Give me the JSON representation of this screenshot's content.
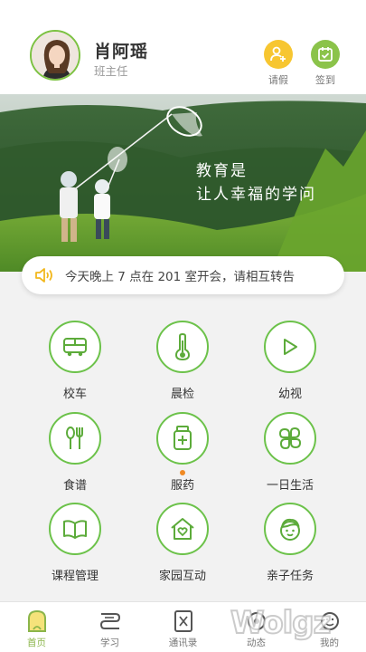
{
  "user": {
    "name": "肖阿瑶",
    "role": "班主任"
  },
  "header_actions": [
    {
      "label": "请假",
      "icon": "leave-icon"
    },
    {
      "label": "签到",
      "icon": "sign-in-icon"
    }
  ],
  "banner": {
    "line1": "教育是",
    "line2": "让人幸福的学问"
  },
  "notice": {
    "text": "今天晚上 7 点在 201 室开会，请相互转告"
  },
  "menu": [
    {
      "label": "校车",
      "icon": "bus-icon"
    },
    {
      "label": "晨检",
      "icon": "thermometer-icon"
    },
    {
      "label": "幼视",
      "icon": "play-icon"
    },
    {
      "label": "食谱",
      "icon": "fork-spoon-icon"
    },
    {
      "label": "服药",
      "icon": "medicine-icon",
      "badge": true
    },
    {
      "label": "一日生活",
      "icon": "clover-icon"
    },
    {
      "label": "课程管理",
      "icon": "book-icon"
    },
    {
      "label": "家园互动",
      "icon": "home-heart-icon"
    },
    {
      "label": "亲子任务",
      "icon": "kid-face-icon"
    }
  ],
  "tabs": [
    {
      "label": "首页",
      "icon": "home-tab-icon",
      "active": true
    },
    {
      "label": "学习",
      "icon": "study-tab-icon"
    },
    {
      "label": "通讯录",
      "icon": "contacts-tab-icon"
    },
    {
      "label": "动态",
      "icon": "moments-tab-icon"
    },
    {
      "label": "我的",
      "icon": "me-tab-icon"
    }
  ],
  "watermark": "Wolgz",
  "colors": {
    "accent_green": "#6cc24a",
    "leave_yellow": "#f7c631",
    "signin_green": "#8bc34a",
    "badge_orange": "#f08a24"
  }
}
